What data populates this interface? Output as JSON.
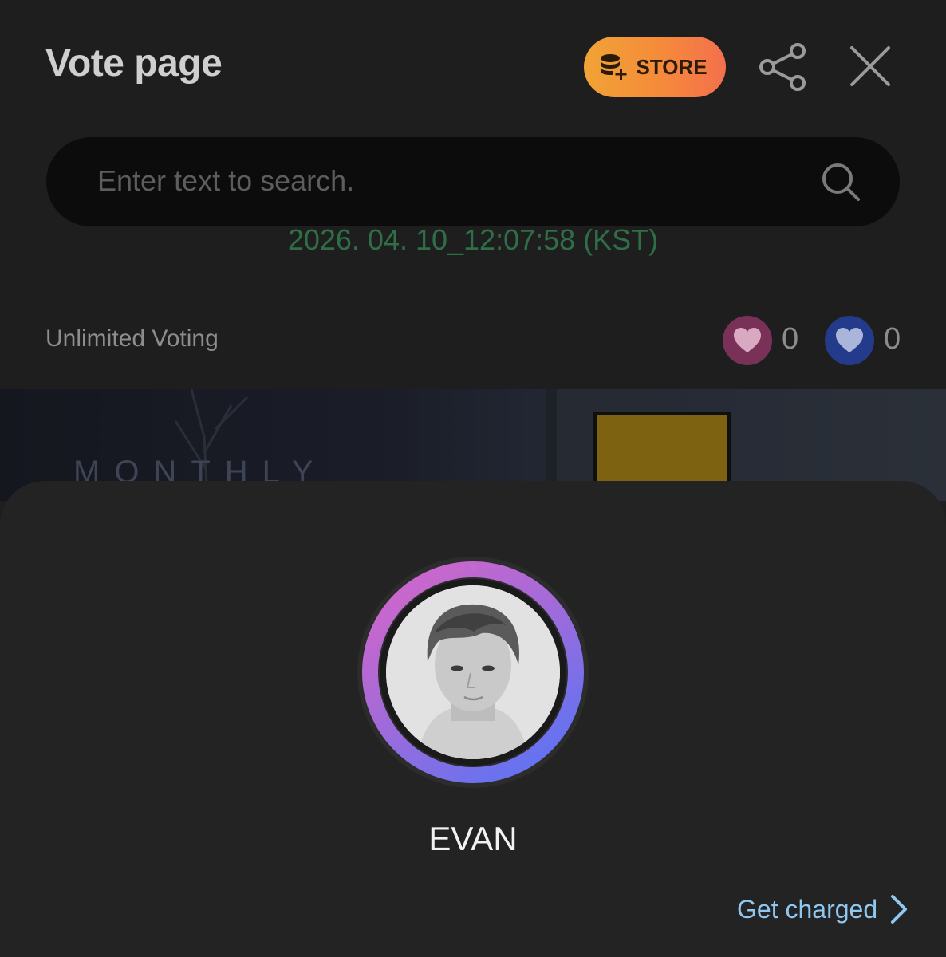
{
  "header": {
    "title": "Vote page",
    "store_label": "STORE"
  },
  "search": {
    "placeholder": "Enter text to search."
  },
  "vote_info": {
    "timestamp": "2026. 04. 10_12:07:58 (KST)",
    "voting_type": "Unlimited Voting",
    "pink_heart_count": "0",
    "blue_heart_count": "0"
  },
  "banner": {
    "text": "MONTHLY"
  },
  "sheet": {
    "member_name": "EVAN",
    "get_charged_label": "Get charged"
  },
  "icons": {
    "store": "coin-stack-plus-icon",
    "share": "share-icon",
    "close": "close-icon",
    "search": "search-icon",
    "heart_pink": "heart-icon",
    "heart_blue": "heart-icon",
    "chevron": "chevron-right-icon"
  },
  "colors": {
    "store_gradient_start": "#f1a336",
    "store_gradient_end": "#f4704d",
    "timestamp": "#2f6e46",
    "pink_badge": "#7a3158",
    "blue_badge": "#243b8c",
    "ring_start": "#d766c8",
    "ring_end": "#6672f0",
    "link": "#8ec7f0"
  }
}
